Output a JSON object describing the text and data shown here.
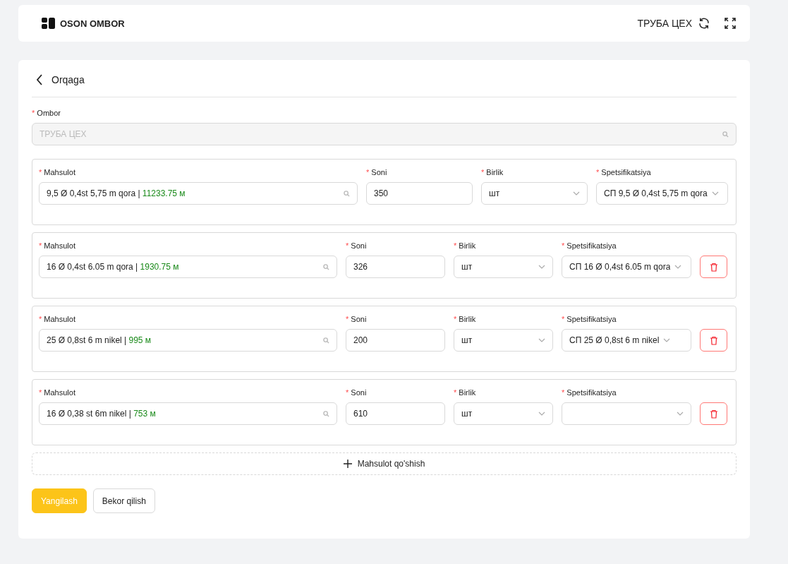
{
  "header": {
    "logo_text": "OSON OMBOR",
    "warehouse": "ТРУБА ЦЕХ"
  },
  "back": {
    "label": "Orqaga"
  },
  "ombor": {
    "label": "Ombor",
    "required_mark": "*",
    "value": "ТРУБА ЦЕХ",
    "disabled": true
  },
  "items": [
    {
      "deletable": false,
      "product": {
        "label": "Mahsulot",
        "required_mark": "*",
        "name": "9,5 Ø 0,4st 5,75 m qora |",
        "stock": "11233.75 м"
      },
      "quantity": {
        "label": "Soni",
        "required_mark": "*",
        "value": "350"
      },
      "unit": {
        "label": "Birlik",
        "required_mark": "*",
        "value": "шт"
      },
      "spec": {
        "label": "Spetsifikatsiya",
        "required_mark": "*",
        "value": "СП 9,5 Ø 0,4st 5,75 m qora"
      }
    },
    {
      "deletable": true,
      "product": {
        "label": "Mahsulot",
        "required_mark": "*",
        "name": "16 Ø 0,4st 6.05 m qora |",
        "stock": "1930.75 м"
      },
      "quantity": {
        "label": "Soni",
        "required_mark": "*",
        "value": "326"
      },
      "unit": {
        "label": "Birlik",
        "required_mark": "*",
        "value": "шт"
      },
      "spec": {
        "label": "Spetsifikatsiya",
        "required_mark": "*",
        "value": "СП 16 Ø 0,4st 6.05 m qora"
      }
    },
    {
      "deletable": true,
      "product": {
        "label": "Mahsulot",
        "required_mark": "*",
        "name": "25 Ø 0,8st 6 m nikel |",
        "stock": "995 м"
      },
      "quantity": {
        "label": "Soni",
        "required_mark": "*",
        "value": "200"
      },
      "unit": {
        "label": "Birlik",
        "required_mark": "*",
        "value": "шт"
      },
      "spec": {
        "label": "Spetsifikatsiya",
        "required_mark": "*",
        "value": "СП 25 Ø 0,8st 6 m nikel"
      }
    },
    {
      "deletable": true,
      "product": {
        "label": "Mahsulot",
        "required_mark": "*",
        "name": "16 Ø 0,38 st 6m nikel |",
        "stock": "753 м"
      },
      "quantity": {
        "label": "Soni",
        "required_mark": "*",
        "value": "610"
      },
      "unit": {
        "label": "Birlik",
        "required_mark": "*",
        "value": "шт"
      },
      "spec": {
        "label": "Spetsifikatsiya",
        "required_mark": "*"
      }
    }
  ],
  "add_button": {
    "label": "Mahsulot qo'shish"
  },
  "buttons": [
    {
      "label": "Yangilash",
      "kind": "primary"
    },
    {
      "label": "Bekor qilish",
      "kind": "default"
    }
  ]
}
